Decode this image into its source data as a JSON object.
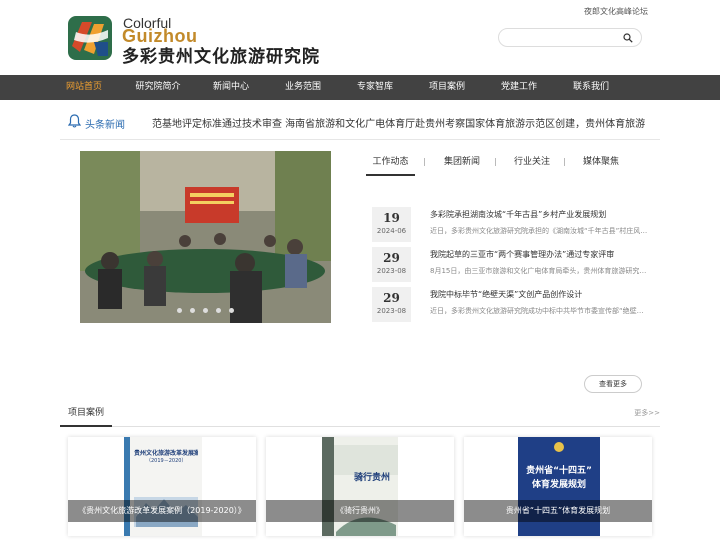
{
  "header": {
    "top_link": "夜郎文化高峰论坛",
    "logo_en_line1": "Colorful",
    "logo_en_line2": "Guizhou",
    "logo_cn": "多彩贵州文化旅游研究院",
    "search_placeholder": "",
    "colors": {
      "accent": "#f0a030",
      "nav_bg": "#424242",
      "logo_gold": "#c28a2a"
    }
  },
  "nav": {
    "items": [
      {
        "label": "网站首页",
        "active": true
      },
      {
        "label": "研究院简介",
        "active": false
      },
      {
        "label": "新闻中心",
        "active": false
      },
      {
        "label": "业务范围",
        "active": false
      },
      {
        "label": "专家智库",
        "active": false
      },
      {
        "label": "项目案例",
        "active": false
      },
      {
        "label": "党建工作",
        "active": false
      },
      {
        "label": "联系我们",
        "active": false
      }
    ]
  },
  "ticker": {
    "label": "头条新闻",
    "icon": "bell-icon",
    "text": "范基地评定标准通过技术审查   海南省旅游和文化广电体育厅赴贵州考察国家体育旅游示范区创建，贵州体育旅游"
  },
  "slider": {
    "dot_count": 5
  },
  "tabs": {
    "items": [
      {
        "label": "工作动态",
        "active": true
      },
      {
        "label": "集团新闻",
        "active": false
      },
      {
        "label": "行业关注",
        "active": false
      },
      {
        "label": "媒体聚焦",
        "active": false
      }
    ],
    "separator": "|"
  },
  "news": [
    {
      "day": "19",
      "ym": "2024-06",
      "title": "多彩院承担湖南汝城“千年古县”乡村产业发展规划",
      "desc": "近日，多彩贵州文化旅游研究院承担的《湖南汝城“千年古县”村庄风…"
    },
    {
      "day": "29",
      "ym": "2023-08",
      "title": "我院起草的三亚市“两个赛事管理办法”通过专家评审",
      "desc": "8月15日，由三亚市旅游和文化广电体育局牵头，贵州体育旅游研究…"
    },
    {
      "day": "29",
      "ym": "2023-08",
      "title": "我院中标毕节“绝壁天渠”文创产品创作设计",
      "desc": "近日，多彩贵州文化旅游研究院成功中标中共毕节市委宣传部“绝壁…"
    }
  ],
  "more_button": "查看更多",
  "cases": {
    "title": "项目案例",
    "more": "更多>>",
    "items": [
      {
        "caption": "《贵州文化旅游改革发展案例（2019-2020）》",
        "book_title": "贵州文化旅游改革发展案例",
        "book_sub": "（2019－2020）"
      },
      {
        "caption": "《骑行贵州》",
        "book_title": "骑行贵州"
      },
      {
        "caption": "贵州省“十四五”体育发展规划",
        "book_title_line1": "贵州省“十四五”",
        "book_title_line2": "体育发展规划"
      }
    ]
  }
}
